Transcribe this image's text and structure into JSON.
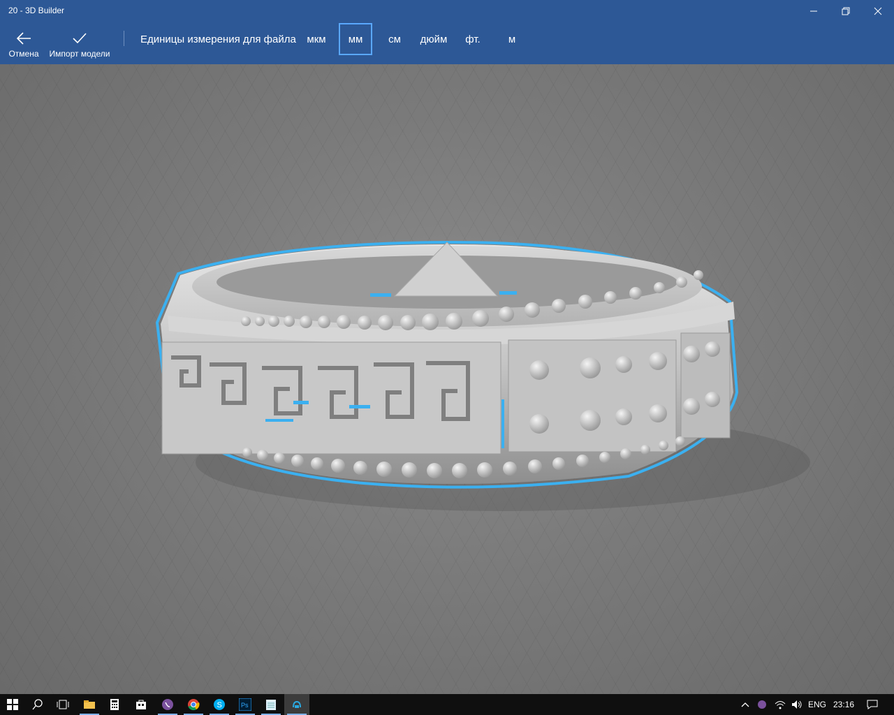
{
  "window": {
    "title": "20 - 3D Builder",
    "minimize_label": "minimize",
    "maximize_label": "restore",
    "close_label": "close"
  },
  "toolbar": {
    "cancel_label": "Отмена",
    "import_label": "Импорт модели",
    "units_label": "Единицы измерения для файла",
    "units": [
      "мкм",
      "мм",
      "см",
      "дюйм",
      "фт.",
      "м"
    ],
    "selected_unit": "мм"
  },
  "viewport": {
    "model": "ring",
    "selection_color": "#3bb0f0",
    "model_color": "#bdbdbd"
  },
  "taskbar": {
    "icons": [
      "windows-start-icon",
      "search-icon",
      "task-view-icon",
      "file-explorer-icon",
      "calculator-icon",
      "store-icon",
      "viber-icon",
      "chrome-icon",
      "skype-icon",
      "photoshop-icon",
      "notepad-icon",
      "3d-builder-icon"
    ],
    "language": "ENG",
    "time": "23:16"
  },
  "colors": {
    "accent": "#2d5896",
    "selected_border": "#5aa8ff"
  }
}
